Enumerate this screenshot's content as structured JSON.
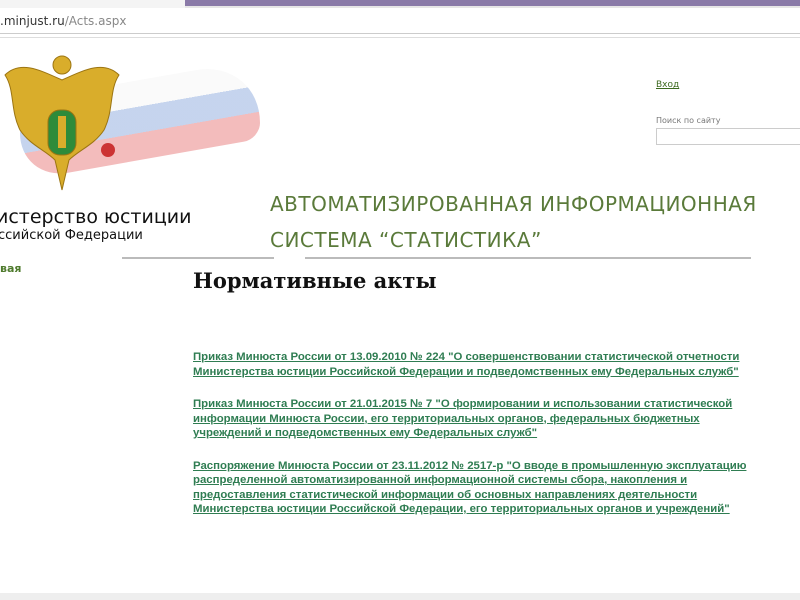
{
  "browser": {
    "url_host": ".minjust.ru",
    "url_path": "/Acts.aspx"
  },
  "header": {
    "ministry_line1": "истерство юстиции",
    "ministry_line2": "ссийской Федерации",
    "system_title_line1": "АВТОМАТИЗИРОВАННАЯ ИНФОРМАЦИОННАЯ",
    "system_title_line2": "СИСТЕМА “СТАТИСТИКА”",
    "login": "Вход",
    "search_label": "Поиск по сайту",
    "search_value": ""
  },
  "nav": {
    "home": "вая"
  },
  "main": {
    "heading": "Нормативные акты",
    "acts": [
      "Приказ Минюста России от 13.09.2010 № 224 \"О совершенствовании статистической отчетности Министерства юстиции Российской Федерации и подведомственных ему Федеральных служб\"",
      "Приказ Минюста России от 21.01.2015 № 7 \"О формировании и использовании статистической информации Минюста России, его территориальных органов, федеральных бюджетных учреждений и подведомственных ему Федеральных служб\"",
      "Распоряжение Минюста России от 23.11.2012 № 2517-р \"О вводе в промышленную эксплуатацию распределенной автоматизированной информационной системы сбора, накопления и предоставления статистической информации об основных направлениях деятельности Министерства юстиции Российской Федерации, его территориальных органов и учреждений\""
    ]
  }
}
